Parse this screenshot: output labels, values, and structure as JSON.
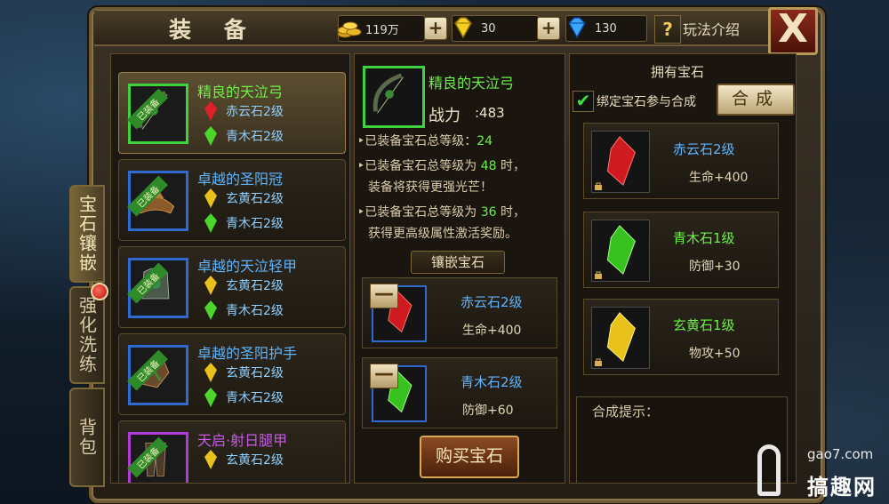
{
  "header": {
    "title": "装 备",
    "gold": "119万",
    "gold_plus": "+",
    "yuanbao": "30",
    "yuanbao_plus": "+",
    "diamond": "130",
    "help_icon_text": "?",
    "help_label": "玩法介绍",
    "close_text": "X"
  },
  "side_tabs": [
    {
      "label": "宝石镶嵌",
      "active": true
    },
    {
      "label": "强化洗练",
      "active": false
    },
    {
      "label": "背包",
      "active": false
    }
  ],
  "equipment_list": [
    {
      "name": "精良的天泣弓",
      "name_color": "#6ef04a",
      "equipped_tag": "已装备",
      "slot_color": "green",
      "gems": [
        {
          "name": "赤云石2级",
          "icon": "red-gem-icon"
        },
        {
          "name": "青木石2级",
          "icon": "green-gem-icon"
        }
      ]
    },
    {
      "name": "卓越的圣阳冠",
      "name_color": "#5fb4ff",
      "equipped_tag": "已装备",
      "slot_color": "blue",
      "gems": [
        {
          "name": "玄黄石2级",
          "icon": "yellow-gem-icon"
        },
        {
          "name": "青木石2级",
          "icon": "green-gem-icon"
        }
      ]
    },
    {
      "name": "卓越的天泣轻甲",
      "name_color": "#5fb4ff",
      "equipped_tag": "已装备",
      "slot_color": "blue",
      "gems": [
        {
          "name": "玄黄石2级",
          "icon": "yellow-gem-icon"
        },
        {
          "name": "青木石2级",
          "icon": "green-gem-icon"
        }
      ]
    },
    {
      "name": "卓越的圣阳护手",
      "name_color": "#5fb4ff",
      "equipped_tag": "已装备",
      "slot_color": "blue",
      "gems": [
        {
          "name": "玄黄石2级",
          "icon": "yellow-gem-icon"
        },
        {
          "name": "青木石2级",
          "icon": "green-gem-icon"
        }
      ]
    },
    {
      "name": "天启·射日腿甲",
      "name_color": "#c65ae8",
      "equipped_tag": "已装备",
      "slot_color": "purple",
      "gems": [
        {
          "name": "玄黄石2级",
          "icon": "yellow-gem-icon"
        }
      ]
    }
  ],
  "selected_item": {
    "name": "精良的天泣弓",
    "power_label": "战力",
    "power_value": ":483",
    "info": [
      {
        "pre": "已装备宝石总等级：",
        "num": "24",
        "post": ""
      },
      {
        "pre": "已装备宝石总等级为 ",
        "num": "48",
        "post": " 时，"
      },
      {
        "pre": "装备将获得更强光芒！",
        "num": "",
        "post": ""
      },
      {
        "pre": "已装备宝石总等级为 ",
        "num": "36",
        "post": " 时，"
      },
      {
        "pre": "获得更高级属性激活奖励。",
        "num": "",
        "post": ""
      }
    ],
    "inlay_title": "镶嵌宝石",
    "sockets": [
      {
        "name": "赤云石2级",
        "stat": "生命+400",
        "icon": "red-gem-icon",
        "remove": "—"
      },
      {
        "name": "青木石2级",
        "stat": "防御+60",
        "icon": "green-gem-icon",
        "remove": "—"
      }
    ],
    "buy_label": "购买宝石"
  },
  "owned_gems": {
    "title": "拥有宝石",
    "bind_checked": "✔",
    "bind_label": "绑定宝石参与合成",
    "compose_label": "合成",
    "items": [
      {
        "name": "赤云石2级",
        "stat": "生命+400",
        "name_color": "#5fb4ff",
        "icon": "red-gem-icon"
      },
      {
        "name": "青木石1级",
        "stat": "防御+30",
        "name_color": "#6ef04a",
        "icon": "green-gem-icon"
      },
      {
        "name": "玄黄石1级",
        "stat": "物攻+50",
        "name_color": "#6ef04a",
        "icon": "yellow-gem-icon"
      }
    ],
    "hint_label": "合成提示："
  },
  "watermark": {
    "site": "gao7.com",
    "name": "搞趣网"
  },
  "colors": {
    "gem_red": "#e0202a",
    "gem_green": "#4ad62a",
    "gem_yellow": "#e8c21a",
    "gem_blue": "#3aa6ff"
  }
}
